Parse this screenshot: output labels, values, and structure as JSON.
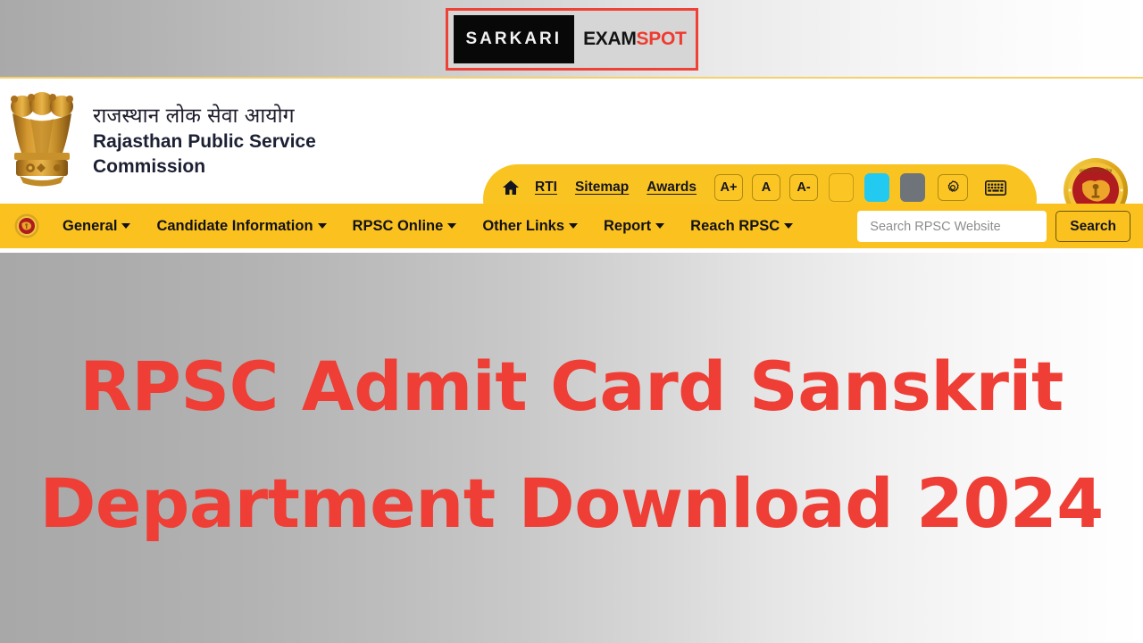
{
  "brand": {
    "logo_left_text": "SARKARI",
    "logo_exam": "EXAM",
    "logo_spot": "SPOT",
    "border_color": "#ef4136",
    "accent_red": "#ef3b30"
  },
  "header": {
    "org_name_hi": "राजस्थान लोक सेवा आयोग",
    "org_name_en": "Rajasthan Public Service Commission",
    "emblem_icon": "ashoka-emblem-icon",
    "seal_icon": "rpsc-seal-icon"
  },
  "utility_bar": {
    "bg_color": "#f9c422",
    "home_icon": "home-icon",
    "links": [
      {
        "label": "RTI"
      },
      {
        "label": "Sitemap"
      },
      {
        "label": "Awards"
      }
    ],
    "font_size_buttons": [
      {
        "label": "A+"
      },
      {
        "label": "A"
      },
      {
        "label": "A-"
      }
    ],
    "theme_swatches": [
      {
        "name": "yellow-theme-swatch",
        "color": "#fbc624"
      },
      {
        "name": "cyan-theme-swatch",
        "color": "#22c9f0"
      },
      {
        "name": "gray-theme-swatch",
        "color": "#6f747b"
      }
    ],
    "gear_icon": "gear-icon",
    "keyboard_icon": "keyboard-icon",
    "social_icons": [
      {
        "name": "desktop-icon"
      },
      {
        "name": "facebook-icon"
      },
      {
        "name": "x-twitter-icon"
      },
      {
        "name": "google-icon"
      },
      {
        "name": "youtube-icon"
      },
      {
        "name": "globe-icon"
      }
    ]
  },
  "navbar": {
    "bg_color": "#fbc21f",
    "logo_icon": "rpsc-seal-icon",
    "items": [
      {
        "label": "General",
        "has_dropdown": true
      },
      {
        "label": "Candidate Information",
        "has_dropdown": true
      },
      {
        "label": "RPSC Online",
        "has_dropdown": true
      },
      {
        "label": "Other Links",
        "has_dropdown": true
      },
      {
        "label": "Report",
        "has_dropdown": true
      },
      {
        "label": "Reach RPSC",
        "has_dropdown": true
      }
    ],
    "search": {
      "placeholder": "Search RPSC Website",
      "value": "",
      "button_label": "Search"
    }
  },
  "hero": {
    "title": "RPSC Admit Card Sanskrit Department Download 2024",
    "title_color": "#ee3e35"
  }
}
